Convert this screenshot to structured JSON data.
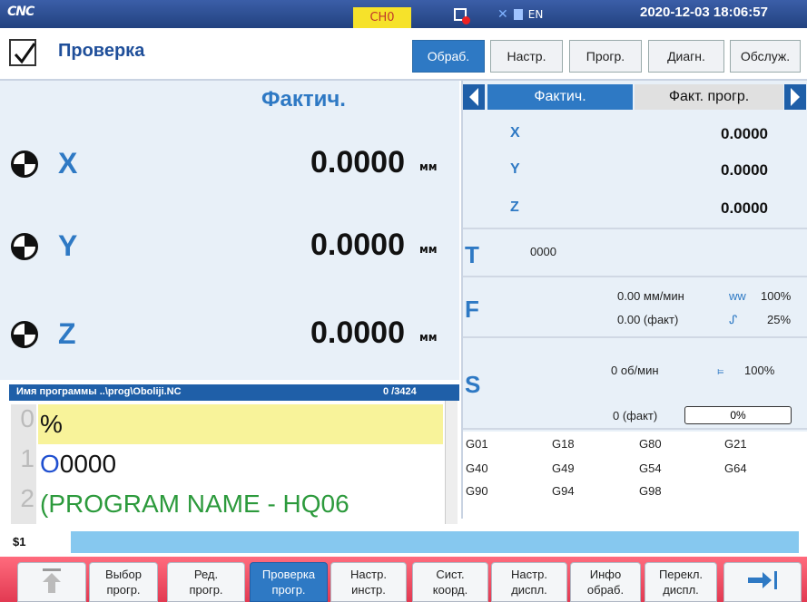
{
  "topbar": {
    "logo": "CNC",
    "channel": "CH0",
    "lang": "EN",
    "datetime": "2020-12-03 18:06:57"
  },
  "header": {
    "title": "Проверка",
    "tabs": [
      "Обраб.",
      "Настр.",
      "Прогр.",
      "Диагн.",
      "Обслуж."
    ],
    "active_tab": 0
  },
  "left": {
    "heading": "Фактич.",
    "unit": "мм",
    "axes": [
      {
        "name": "X",
        "value": "0.0000"
      },
      {
        "name": "Y",
        "value": "0.0000"
      },
      {
        "name": "Z",
        "value": "0.0000"
      }
    ]
  },
  "right": {
    "tab_active": "Фактич.",
    "tab_other": "Факт. прогр.",
    "axes": [
      {
        "name": "X",
        "value": "0.0000"
      },
      {
        "name": "Y",
        "value": "0.0000"
      },
      {
        "name": "Z",
        "value": "0.0000"
      }
    ],
    "T": {
      "label": "T",
      "value": "0000"
    },
    "F": {
      "label": "F",
      "line1": "0.00 мм/мин",
      "line1_pct": "100%",
      "line2": "0.00 (факт)",
      "line2_pct": "25%"
    },
    "S": {
      "label": "S",
      "line1": "0 об/мин",
      "line1_pct": "100%",
      "line2": "0 (факт)",
      "bar_text": "0%"
    },
    "gcodes": [
      [
        "G01",
        "G18",
        "G80",
        "G21"
      ],
      [
        "G40",
        "G49",
        "G54",
        "G64"
      ],
      [
        "G90",
        "G94",
        "G98",
        ""
      ]
    ]
  },
  "program": {
    "label": "Имя программы ..\\prog\\Oboliji.NC",
    "position": "0 /3424",
    "lines": [
      {
        "num": "0",
        "text": "%"
      },
      {
        "num": "1",
        "text_prefix": "O",
        "text": "0000"
      },
      {
        "num": "2",
        "text": "(PROGRAM NAME - HQ06"
      }
    ]
  },
  "command": {
    "label": "$1",
    "value": ""
  },
  "bottom": {
    "buttons": [
      {
        "l1": "",
        "l2": ""
      },
      {
        "l1": "Выбор",
        "l2": "прогр."
      },
      {
        "l1": "Ред.",
        "l2": "прогр."
      },
      {
        "l1": "Проверка",
        "l2": "прогр."
      },
      {
        "l1": "Настр.",
        "l2": "инстр."
      },
      {
        "l1": "Сист.",
        "l2": "коорд."
      },
      {
        "l1": "Настр.",
        "l2": "диспл."
      },
      {
        "l1": "Инфо",
        "l2": "обраб."
      },
      {
        "l1": "Перекл.",
        "l2": "диспл."
      },
      {
        "l1": "",
        "l2": ""
      }
    ]
  }
}
